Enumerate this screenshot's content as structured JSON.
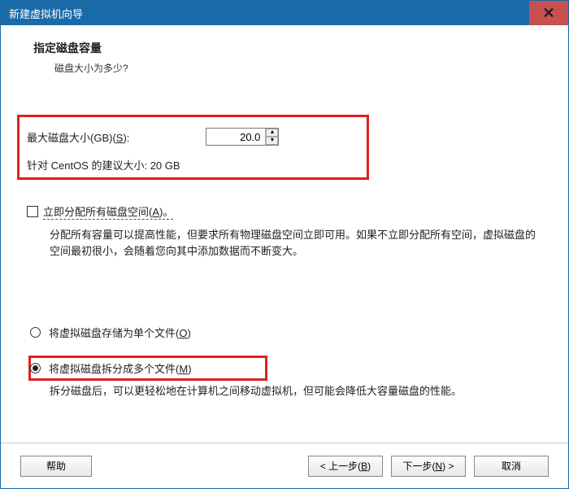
{
  "titlebar": {
    "title": "新建虚拟机向导"
  },
  "heading": "指定磁盘容量",
  "subheading": "磁盘大小为多少?",
  "disk": {
    "label_prefix": "最大磁盘大小(GB)(",
    "hotkey": "S",
    "label_suffix": "):",
    "value": "20.0",
    "recommend": "针对 CentOS 的建议大小: 20 GB"
  },
  "allocate": {
    "label_prefix": "立即分配所有磁盘空间(",
    "hotkey": "A",
    "label_suffix": ")。",
    "desc": "分配所有容量可以提高性能，但要求所有物理磁盘空间立即可用。如果不立即分配所有空间，虚拟磁盘的空间最初很小，会随着您向其中添加数据而不断变大。"
  },
  "radios": {
    "single": {
      "prefix": "将虚拟磁盘存储为单个文件(",
      "hotkey": "O",
      "suffix": ")"
    },
    "split": {
      "prefix": "将虚拟磁盘拆分成多个文件(",
      "hotkey": "M",
      "suffix": ")",
      "desc": "拆分磁盘后，可以更轻松地在计算机之间移动虚拟机，但可能会降低大容量磁盘的性能。"
    }
  },
  "footer": {
    "help": "帮助",
    "back_prefix": "< 上一步(",
    "back_hot": "B",
    "back_suffix": ")",
    "next_prefix": "下一步(",
    "next_hot": "N",
    "next_suffix": ") >",
    "cancel": "取消"
  }
}
